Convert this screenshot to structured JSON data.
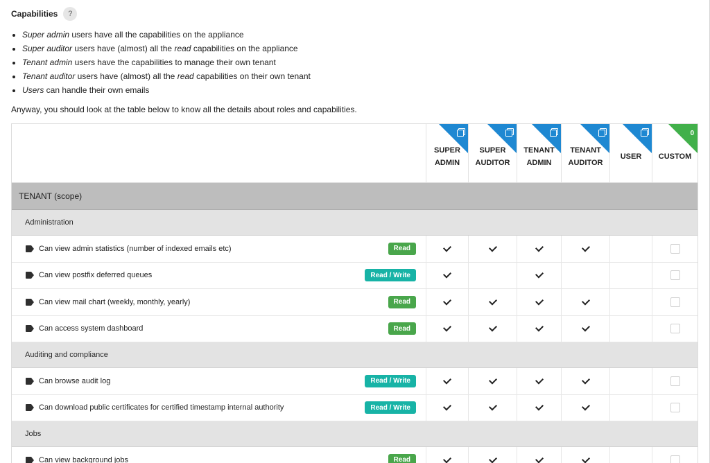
{
  "title": "Capabilities",
  "help_label": "?",
  "roles": [
    {
      "em": "Super admin",
      "pre": "",
      "mid": " users have all the capabilities on the appliance",
      "em2": "",
      "post": ""
    },
    {
      "em": "Super auditor",
      "pre": "",
      "mid": " users have (almost) all the ",
      "em2": "read",
      "post": " capabilities on the appliance"
    },
    {
      "em": "Tenant admin",
      "pre": "",
      "mid": " users have the capabilities to manage their own tenant",
      "em2": "",
      "post": ""
    },
    {
      "em": "Tenant auditor",
      "pre": "",
      "mid": " users have (almost) all the ",
      "em2": "read",
      "post": " capabilities on their own tenant"
    },
    {
      "em": "Users",
      "pre": "",
      "mid": " can handle their own emails",
      "em2": "",
      "post": ""
    }
  ],
  "note": "Anyway, you should look at the table below to know all the details about roles and capabilities.",
  "columns": [
    {
      "line1": "SUPER",
      "line2": "ADMIN",
      "corner": "copy-icon"
    },
    {
      "line1": "SUPER",
      "line2": "AUDITOR",
      "corner": "copy-icon"
    },
    {
      "line1": "TENANT",
      "line2": "ADMIN",
      "corner": "copy-icon"
    },
    {
      "line1": "TENANT",
      "line2": "AUDITOR",
      "corner": "copy-icon"
    },
    {
      "line1": "USER",
      "line2": "",
      "corner": "copy-icon"
    },
    {
      "line1": "CUSTOM",
      "line2": "",
      "corner": "count",
      "count": "0"
    }
  ],
  "colors": {
    "corner_blue": "#1e88d2",
    "corner_green": "#41b04a",
    "read_badge": "#49a64b",
    "rw_badge": "#17b3a6"
  },
  "scope": "TENANT (scope)",
  "sections": [
    {
      "name": "Administration",
      "rows": [
        {
          "label": "Can view admin statistics (number of indexed emails etc)",
          "badge": "Read",
          "type": "read",
          "checks": [
            true,
            true,
            true,
            true,
            false
          ]
        },
        {
          "label": "Can view postfix deferred queues",
          "badge": "Read / Write",
          "type": "rw",
          "checks": [
            true,
            false,
            true,
            false,
            false
          ]
        },
        {
          "label": "Can view mail chart (weekly, monthly, yearly)",
          "badge": "Read",
          "type": "read",
          "checks": [
            true,
            true,
            true,
            true,
            false
          ]
        },
        {
          "label": "Can access system dashboard",
          "badge": "Read",
          "type": "read",
          "checks": [
            true,
            true,
            true,
            true,
            false
          ]
        }
      ]
    },
    {
      "name": "Auditing and compliance",
      "rows": [
        {
          "label": "Can browse audit log",
          "badge": "Read / Write",
          "type": "rw",
          "checks": [
            true,
            true,
            true,
            true,
            false
          ]
        },
        {
          "label": "Can download public certificates for certified timestamp internal authority",
          "badge": "Read / Write",
          "type": "rw",
          "checks": [
            true,
            true,
            true,
            true,
            false
          ]
        }
      ]
    },
    {
      "name": "Jobs",
      "rows": [
        {
          "label": "Can view background jobs",
          "badge": "Read",
          "type": "read",
          "checks": [
            true,
            true,
            true,
            true,
            false
          ]
        }
      ]
    }
  ]
}
